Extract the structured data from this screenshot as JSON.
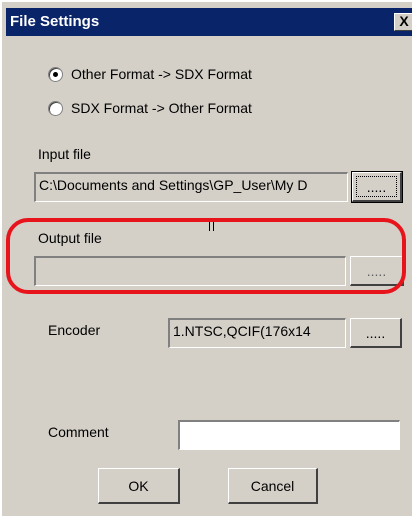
{
  "window": {
    "title": "File Settings",
    "close_label": "X"
  },
  "conversion": {
    "options": [
      {
        "label": "Other Format -> SDX Format",
        "selected": true
      },
      {
        "label": "SDX Format -> Other Format",
        "selected": false
      }
    ]
  },
  "input_file": {
    "label": "Input file",
    "value": "C:\\Documents and Settings\\GP_User\\My D",
    "browse_label": "....."
  },
  "output_file": {
    "label": "Output file",
    "value": "",
    "browse_label": "....."
  },
  "encoder": {
    "label": "Encoder",
    "value": "1.NTSC,QCIF(176x14",
    "browse_label": "....."
  },
  "comment": {
    "label": "Comment",
    "value": ""
  },
  "buttons": {
    "ok": "OK",
    "cancel": "Cancel"
  },
  "colors": {
    "title_bar": "#0a246a",
    "dialog_bg": "#d4d0c8",
    "highlight": "#e8141c"
  }
}
